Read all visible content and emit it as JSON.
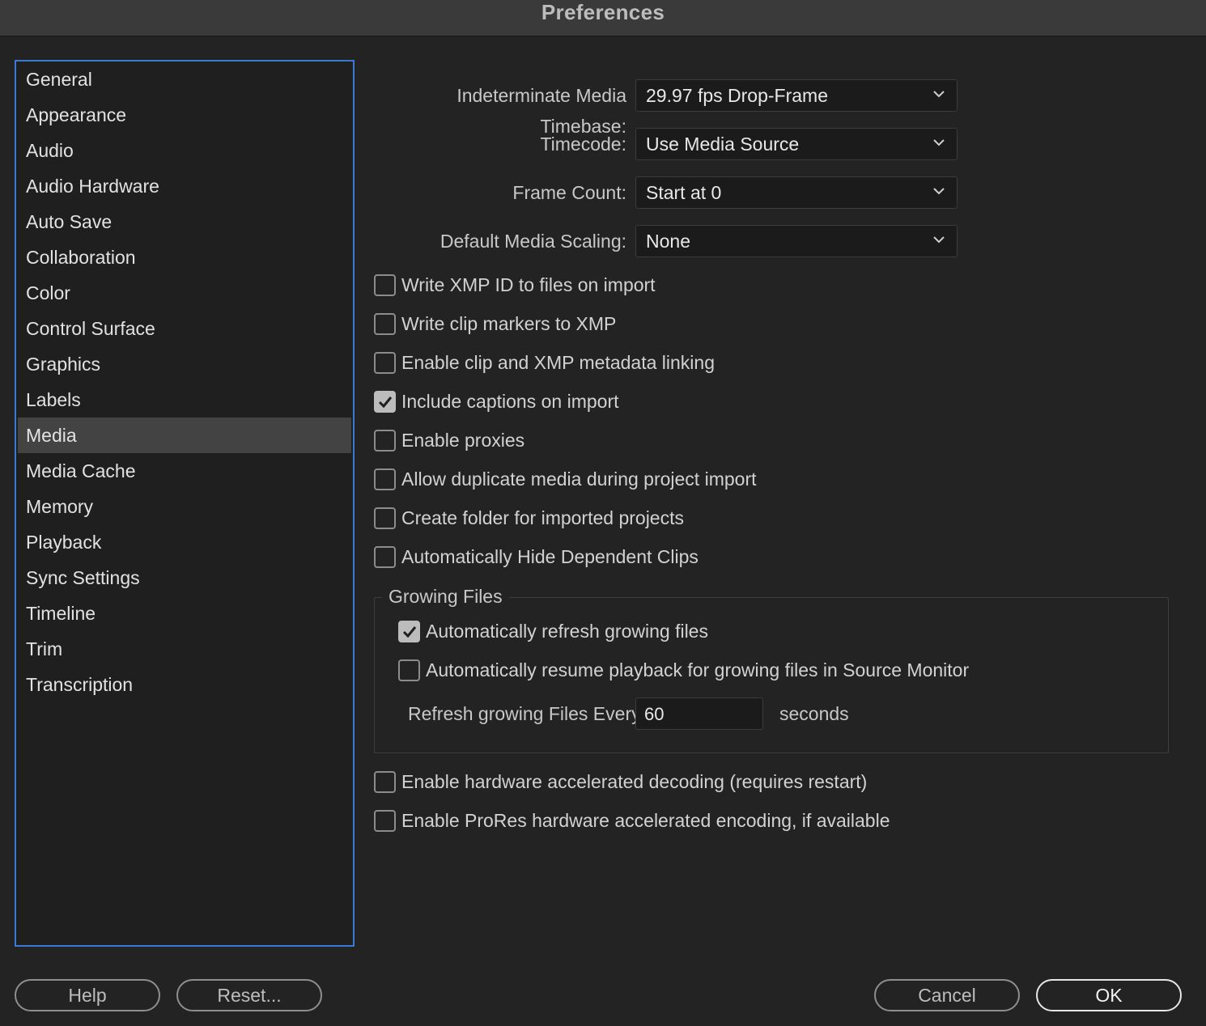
{
  "window": {
    "title": "Preferences"
  },
  "sidebar": {
    "selected": "Media",
    "items": [
      {
        "label": "General"
      },
      {
        "label": "Appearance"
      },
      {
        "label": "Audio"
      },
      {
        "label": "Audio Hardware"
      },
      {
        "label": "Auto Save"
      },
      {
        "label": "Collaboration"
      },
      {
        "label": "Color"
      },
      {
        "label": "Control Surface"
      },
      {
        "label": "Graphics"
      },
      {
        "label": "Labels"
      },
      {
        "label": "Media"
      },
      {
        "label": "Media Cache"
      },
      {
        "label": "Memory"
      },
      {
        "label": "Playback"
      },
      {
        "label": "Sync Settings"
      },
      {
        "label": "Timeline"
      },
      {
        "label": "Trim"
      },
      {
        "label": "Transcription"
      }
    ]
  },
  "media": {
    "timebase": {
      "label": "Indeterminate Media Timebase:",
      "value": "29.97 fps Drop-Frame"
    },
    "timecode": {
      "label": "Timecode:",
      "value": "Use Media Source"
    },
    "frame_count": {
      "label": "Frame Count:",
      "value": "Start at 0"
    },
    "scaling": {
      "label": "Default Media Scaling:",
      "value": "None"
    },
    "checkboxes": [
      {
        "label": "Write XMP ID to files on import",
        "checked": false
      },
      {
        "label": "Write clip markers to XMP",
        "checked": false
      },
      {
        "label": "Enable clip and XMP metadata linking",
        "checked": false
      },
      {
        "label": "Include captions on import",
        "checked": true
      },
      {
        "label": "Enable proxies",
        "checked": false
      },
      {
        "label": "Allow duplicate media during project import",
        "checked": false
      },
      {
        "label": "Create folder for imported projects",
        "checked": false
      },
      {
        "label": "Automatically Hide Dependent Clips",
        "checked": false
      }
    ],
    "growing_files": {
      "title": "Growing Files",
      "auto_refresh": {
        "label": "Automatically refresh growing files",
        "checked": true
      },
      "auto_resume": {
        "label": "Automatically resume playback for growing files in Source Monitor",
        "checked": false
      },
      "refresh_label": "Refresh growing Files Every",
      "refresh_value": "60",
      "refresh_unit": "seconds"
    },
    "hw_decoding": {
      "label": "Enable hardware accelerated decoding (requires restart)",
      "checked": false
    },
    "prores_encoding": {
      "label": "Enable ProRes hardware accelerated encoding, if available",
      "checked": false
    }
  },
  "footer": {
    "help": "Help",
    "reset": "Reset...",
    "cancel": "Cancel",
    "ok": "OK"
  },
  "colors": {
    "background": "#232323",
    "sidebar_border": "#3a7ad6",
    "selected_item": "#434343"
  }
}
